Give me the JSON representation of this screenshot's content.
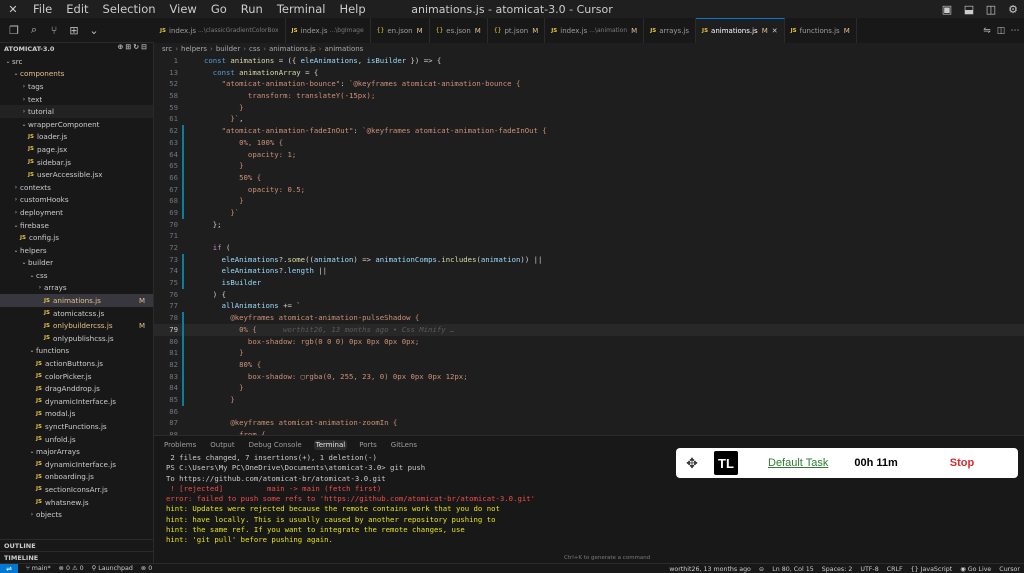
{
  "window": {
    "title": "animations.js - atomicat-3.0 - Cursor"
  },
  "menu": [
    "File",
    "Edit",
    "Selection",
    "View",
    "Go",
    "Run",
    "Terminal",
    "Help"
  ],
  "explorer": {
    "header": "ATOMICAT-3.0",
    "tree": [
      {
        "label": "src",
        "depth": 0,
        "type": "folder",
        "open": true
      },
      {
        "label": "components",
        "depth": 1,
        "type": "folder",
        "open": true,
        "accent": true
      },
      {
        "label": "tags",
        "depth": 2,
        "type": "folder",
        "open": false
      },
      {
        "label": "text",
        "depth": 2,
        "type": "folder",
        "open": false
      },
      {
        "label": "tutorial",
        "depth": 2,
        "type": "folder",
        "open": false,
        "hl": true
      },
      {
        "label": "wrapperComponent",
        "depth": 2,
        "type": "folder",
        "open": true
      },
      {
        "label": "loader.js",
        "depth": 2,
        "type": "js"
      },
      {
        "label": "page.jsx",
        "depth": 2,
        "type": "js"
      },
      {
        "label": "sidebar.js",
        "depth": 2,
        "type": "js"
      },
      {
        "label": "userAccessible.jsx",
        "depth": 2,
        "type": "js"
      },
      {
        "label": "contexts",
        "depth": 1,
        "type": "folder",
        "open": false
      },
      {
        "label": "customHooks",
        "depth": 1,
        "type": "folder",
        "open": false
      },
      {
        "label": "deployment",
        "depth": 1,
        "type": "folder",
        "open": false
      },
      {
        "label": "firebase",
        "depth": 1,
        "type": "folder",
        "open": true
      },
      {
        "label": "config.js",
        "depth": 1,
        "type": "js"
      },
      {
        "label": "helpers",
        "depth": 1,
        "type": "folder",
        "open": true
      },
      {
        "label": "builder",
        "depth": 2,
        "type": "folder",
        "open": true
      },
      {
        "label": "css",
        "depth": 3,
        "type": "folder",
        "open": true
      },
      {
        "label": "arrays",
        "depth": 4,
        "type": "folder",
        "open": false
      },
      {
        "label": "animations.js",
        "depth": 4,
        "type": "js",
        "selected": true,
        "badge": "M"
      },
      {
        "label": "atomicatcss.js",
        "depth": 4,
        "type": "js"
      },
      {
        "label": "onlybuildercss.js",
        "depth": 4,
        "type": "js",
        "modified": true,
        "badge": "M"
      },
      {
        "label": "onlypublishcss.js",
        "depth": 4,
        "type": "js"
      },
      {
        "label": "functions",
        "depth": 3,
        "type": "folder",
        "open": true
      },
      {
        "label": "actionButtons.js",
        "depth": 3,
        "type": "js"
      },
      {
        "label": "colorPicker.js",
        "depth": 3,
        "type": "js"
      },
      {
        "label": "dragAnddrop.js",
        "depth": 3,
        "type": "js"
      },
      {
        "label": "dynamicInterface.js",
        "depth": 3,
        "type": "js"
      },
      {
        "label": "modal.js",
        "depth": 3,
        "type": "js"
      },
      {
        "label": "synctFunctions.js",
        "depth": 3,
        "type": "js"
      },
      {
        "label": "unfold.js",
        "depth": 3,
        "type": "js"
      },
      {
        "label": "majorArrays",
        "depth": 3,
        "type": "folder",
        "open": true
      },
      {
        "label": "dynamicInterface.js",
        "depth": 3,
        "type": "js"
      },
      {
        "label": "onboarding.js",
        "depth": 3,
        "type": "js"
      },
      {
        "label": "sectionIconsArr.js",
        "depth": 3,
        "type": "js"
      },
      {
        "label": "whatsnew.js",
        "depth": 3,
        "type": "js"
      },
      {
        "label": "objects",
        "depth": 3,
        "type": "folder",
        "open": false
      }
    ],
    "outline": "OUTLINE",
    "timeline": "TIMELINE"
  },
  "tabs": [
    {
      "icon": "JS",
      "name": "index.js",
      "desc": "...\\classicGradientColorBox",
      "active": false,
      "modified": ""
    },
    {
      "icon": "JS",
      "name": "index.js",
      "desc": "...\\bgImage",
      "active": false,
      "modified": ""
    },
    {
      "icon": "{}",
      "name": "en.json",
      "desc": "",
      "active": false,
      "modified": "M"
    },
    {
      "icon": "{}",
      "name": "es.json",
      "desc": "",
      "active": false,
      "modified": "M"
    },
    {
      "icon": "{}",
      "name": "pt.json",
      "desc": "",
      "active": false,
      "modified": "M"
    },
    {
      "icon": "JS",
      "name": "index.js",
      "desc": "...\\animation",
      "active": false,
      "modified": "M"
    },
    {
      "icon": "JS",
      "name": "arrays.js",
      "desc": "",
      "active": false,
      "modified": ""
    },
    {
      "icon": "JS",
      "name": "animations.js",
      "desc": "",
      "active": true,
      "modified": "M"
    },
    {
      "icon": "JS",
      "name": "functions.js",
      "desc": "",
      "active": false,
      "modified": "M"
    }
  ],
  "breadcrumb": [
    "src",
    "helpers",
    "builder",
    "css",
    "animations.js",
    "animations"
  ],
  "code": [
    {
      "n": "1",
      "t": [
        [
          "kw",
          "const "
        ],
        [
          "fn",
          "animations"
        ],
        [
          "p",
          " = ({ "
        ],
        [
          "var",
          "eleAnimations"
        ],
        [
          "p",
          ", "
        ],
        [
          "var",
          "isBuilder"
        ],
        [
          "p",
          " }) => {"
        ]
      ]
    },
    {
      "n": "13",
      "t": [
        [
          "p",
          "  "
        ],
        [
          "kw",
          "const "
        ],
        [
          "fn",
          "animationArray"
        ],
        [
          "p",
          " = {"
        ]
      ]
    },
    {
      "n": "52",
      "t": [
        [
          "p",
          "    "
        ],
        [
          "str",
          "\"atomicat-animation-bounce\""
        ],
        [
          "p",
          ": "
        ],
        [
          "str",
          "`@keyframes atomicat-animation-bounce {"
        ]
      ]
    },
    {
      "n": "58",
      "t": [
        [
          "str",
          "          transform: translateY(-15px);"
        ]
      ]
    },
    {
      "n": "59",
      "t": [
        [
          "str",
          "        }"
        ]
      ]
    },
    {
      "n": "61",
      "t": [
        [
          "str",
          "      }`"
        ],
        [
          "p",
          ","
        ]
      ]
    },
    {
      "n": "62",
      "t": [
        [
          "p",
          "    "
        ],
        [
          "str",
          "\"atomicat-animation-fadeInOut\""
        ],
        [
          "p",
          ": "
        ],
        [
          "str",
          "`@keyframes atomicat-animation-fadeInOut {"
        ]
      ],
      "bar": true
    },
    {
      "n": "63",
      "t": [
        [
          "str",
          "        0%, 100% {"
        ]
      ],
      "bar": true
    },
    {
      "n": "64",
      "t": [
        [
          "str",
          "          opacity: 1;"
        ]
      ],
      "bar": true
    },
    {
      "n": "65",
      "t": [
        [
          "str",
          "        }"
        ]
      ],
      "bar": true
    },
    {
      "n": "66",
      "t": [
        [
          "str",
          "        50% {"
        ]
      ],
      "bar": true
    },
    {
      "n": "67",
      "t": [
        [
          "str",
          "          opacity: 0.5;"
        ]
      ],
      "bar": true
    },
    {
      "n": "68",
      "t": [
        [
          "str",
          "        }"
        ]
      ],
      "bar": true
    },
    {
      "n": "69",
      "t": [
        [
          "str",
          "      }`"
        ]
      ],
      "bar": true
    },
    {
      "n": "70",
      "t": [
        [
          "p",
          "  };"
        ]
      ]
    },
    {
      "n": "71",
      "t": [
        [
          "p",
          ""
        ]
      ]
    },
    {
      "n": "72",
      "t": [
        [
          "p",
          "  "
        ],
        [
          "kw2",
          "if"
        ],
        [
          "p",
          " ("
        ]
      ]
    },
    {
      "n": "73",
      "t": [
        [
          "p",
          "    "
        ],
        [
          "var",
          "eleAnimations"
        ],
        [
          "p",
          "?."
        ],
        [
          "fn",
          "some"
        ],
        [
          "p",
          "(("
        ],
        [
          "var",
          "animation"
        ],
        [
          "p",
          ") => "
        ],
        [
          "var",
          "animationComps"
        ],
        [
          "p",
          "."
        ],
        [
          "fn",
          "includes"
        ],
        [
          "p",
          "("
        ],
        [
          "var",
          "animation"
        ],
        [
          "p",
          ")) ||"
        ]
      ],
      "bar": true
    },
    {
      "n": "74",
      "t": [
        [
          "p",
          "    "
        ],
        [
          "var",
          "eleAnimations"
        ],
        [
          "p",
          "?."
        ],
        [
          "var",
          "length"
        ],
        [
          "p",
          " ||"
        ]
      ],
      "bar": true
    },
    {
      "n": "75",
      "t": [
        [
          "p",
          "    "
        ],
        [
          "var",
          "isBuilder"
        ]
      ],
      "bar": true
    },
    {
      "n": "76",
      "t": [
        [
          "p",
          "  ) {"
        ]
      ]
    },
    {
      "n": "77",
      "t": [
        [
          "p",
          "    "
        ],
        [
          "var",
          "allAnimations"
        ],
        [
          "p",
          " += `"
        ]
      ]
    },
    {
      "n": "78",
      "t": [
        [
          "str",
          "      @keyframes atomicat-animation-pulseShadow {"
        ]
      ],
      "bar": true
    },
    {
      "n": "79",
      "t": [
        [
          "str",
          "        0% {"
        ],
        [
          "blame",
          "      worthit26, 13 months ago • Css Minify …"
        ]
      ],
      "bar": true,
      "cur": true
    },
    {
      "n": "80",
      "t": [
        [
          "str",
          "          box-shadow: rgb(0 0 0) 0px 0px 0px 0px;"
        ]
      ],
      "bar": true
    },
    {
      "n": "81",
      "t": [
        [
          "str",
          "        }"
        ]
      ],
      "bar": true
    },
    {
      "n": "82",
      "t": [
        [
          "str",
          "        80% {"
        ]
      ],
      "bar": true
    },
    {
      "n": "83",
      "t": [
        [
          "str",
          "          box-shadow: ▢rgba(0, 255, 23, 0) 0px 0px 0px 12px;"
        ]
      ],
      "bar": true
    },
    {
      "n": "84",
      "t": [
        [
          "str",
          "        }"
        ]
      ],
      "bar": true
    },
    {
      "n": "85",
      "t": [
        [
          "str",
          "      }"
        ]
      ],
      "bar": true
    },
    {
      "n": "86",
      "t": [
        [
          "p",
          ""
        ]
      ]
    },
    {
      "n": "87",
      "t": [
        [
          "str",
          "      @keyframes atomicat-animation-zoomIn {"
        ]
      ]
    },
    {
      "n": "88",
      "t": [
        [
          "str",
          "        from {"
        ]
      ]
    }
  ],
  "panel": {
    "tabs": [
      "Problems",
      "Output",
      "Debug Console",
      "Terminal",
      "Ports",
      "GitLens"
    ],
    "active_tab": "Terminal",
    "terminal": [
      {
        "c": "norm",
        "t": " 2 files changed, 7 insertions(+), 1 deletion(-)"
      },
      {
        "c": "norm",
        "t": "PS C:\\Users\\My PC\\OneDrive\\Documents\\atomicat-3.0> git push"
      },
      {
        "c": "norm",
        "t": "To https://github.com/atomicat-br/atomicat-3.0.git"
      },
      {
        "c": "err",
        "t": " ! [rejected]          main -> main (fetch first)"
      },
      {
        "c": "err",
        "t": "error: failed to push some refs to 'https://github.com/atomicat-br/atomicat-3.0.git'"
      },
      {
        "c": "warn",
        "t": "hint: Updates were rejected because the remote contains work that you do not"
      },
      {
        "c": "warn",
        "t": "hint: have locally. This is usually caused by another repository pushing to"
      },
      {
        "c": "warn",
        "t": "hint: the same ref. If you want to integrate the remote changes, use"
      },
      {
        "c": "warn",
        "t": "hint: 'git pull' before pushing again."
      }
    ],
    "hint": "Ctrl+K to generate a command"
  },
  "tracker": {
    "logo": "TL",
    "task": "Default Task",
    "time": "00h 11m",
    "stop": "Stop"
  },
  "status": {
    "branch": "main*",
    "errors": "0 ⚠ 0",
    "launchpad": "Launchpad",
    "ports": "0",
    "blame": "worthit26, 13 months ago",
    "position": "Ln 80, Col 15",
    "spaces": "Spaces: 2",
    "encoding": "UTF-8",
    "eol": "CRLF",
    "language": "JavaScript",
    "golive": "Go Live",
    "app": "Cursor"
  },
  "colors": {
    "kw": "#569cd6",
    "kw2": "#c586c0",
    "fn": "#dcdcaa",
    "var": "#9cdcfe",
    "str": "#ce9178",
    "p": "#d4d4d4",
    "blame": "#5a5a5a"
  }
}
